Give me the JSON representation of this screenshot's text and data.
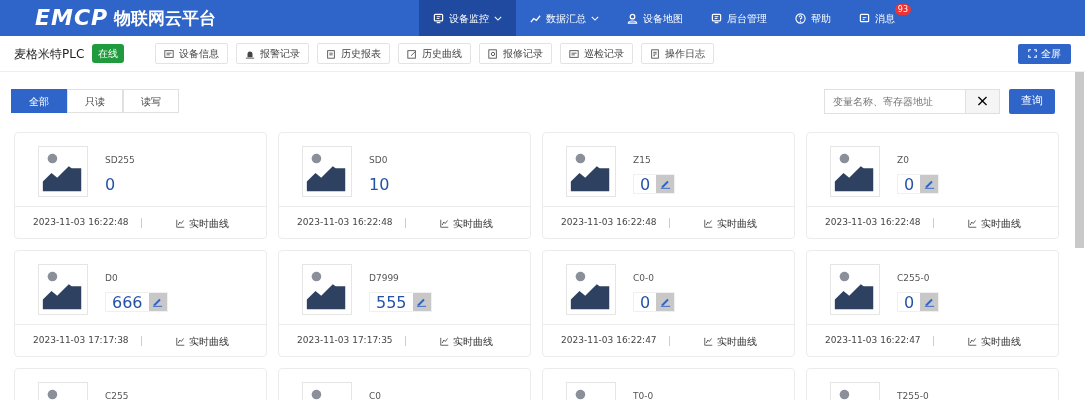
{
  "header": {
    "logo": "EMCP",
    "title": "物联网云平台",
    "nav": [
      {
        "label": "设备监控",
        "dropdown": true,
        "selected": true
      },
      {
        "label": "数据汇总",
        "dropdown": true,
        "selected": false
      },
      {
        "label": "设备地图",
        "dropdown": false,
        "selected": false
      },
      {
        "label": "后台管理",
        "dropdown": false,
        "selected": false
      },
      {
        "label": "帮助",
        "dropdown": false,
        "selected": false
      },
      {
        "label": "消息",
        "dropdown": false,
        "selected": false,
        "badge": "93"
      }
    ]
  },
  "device": {
    "name": "麦格米特PLC",
    "status": "在线",
    "tools": [
      "设备信息",
      "报警记录",
      "历史报表",
      "历史曲线",
      "报修记录",
      "巡检记录",
      "操作日志"
    ],
    "fullscreen": "全屏"
  },
  "filters": [
    {
      "label": "全部",
      "selected": true
    },
    {
      "label": "只读",
      "selected": false
    },
    {
      "label": "读写",
      "selected": false
    }
  ],
  "search": {
    "placeholder": "变量名称、寄存器地址",
    "clear": "×",
    "button": "查询"
  },
  "variables": [
    {
      "name": "SD255",
      "value": "0",
      "writable": false,
      "time": "2023-11-03 16:22:48",
      "link": "实时曲线"
    },
    {
      "name": "SD0",
      "value": "10",
      "writable": false,
      "time": "2023-11-03 16:22:48",
      "link": "实时曲线"
    },
    {
      "name": "Z15",
      "value": "0",
      "writable": true,
      "time": "2023-11-03 16:22:48",
      "link": "实时曲线"
    },
    {
      "name": "Z0",
      "value": "0",
      "writable": true,
      "time": "2023-11-03 16:22:48",
      "link": "实时曲线"
    },
    {
      "name": "D0",
      "value": "666",
      "writable": true,
      "time": "2023-11-03 17:17:38",
      "link": "实时曲线"
    },
    {
      "name": "D7999",
      "value": "555",
      "writable": true,
      "time": "2023-11-03 17:17:35",
      "link": "实时曲线"
    },
    {
      "name": "C0-0",
      "value": "0",
      "writable": true,
      "time": "2023-11-03 16:22:47",
      "link": "实时曲线"
    },
    {
      "name": "C255-0",
      "value": "0",
      "writable": true,
      "time": "2023-11-03 16:22:47",
      "link": "实时曲线"
    },
    {
      "name": "C255"
    },
    {
      "name": "C0"
    },
    {
      "name": "T0-0"
    },
    {
      "name": "T255-0"
    }
  ]
}
